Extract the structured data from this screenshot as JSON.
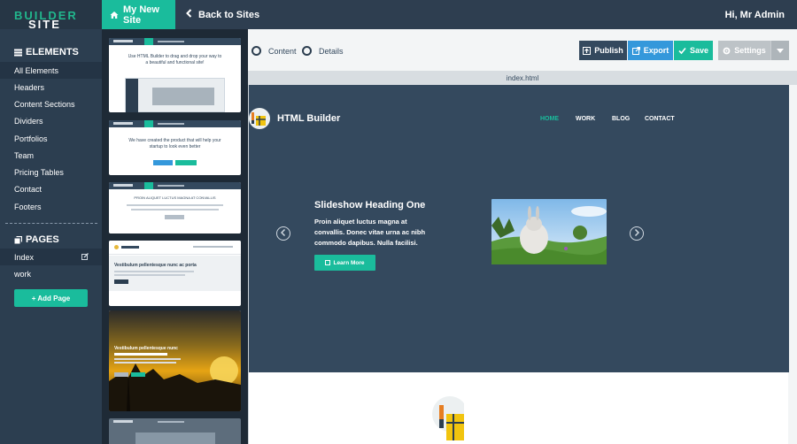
{
  "app": {
    "logo_part1": "SITE",
    "logo_part2": "BUILDER",
    "site_tab": "My New Site",
    "back_link": "Back to Sites",
    "greeting": "Hi, Mr Admin"
  },
  "sidebar": {
    "elements_heading": "ELEMENTS",
    "elements": [
      "All Elements",
      "Headers",
      "Content Sections",
      "Dividers",
      "Portfolios",
      "Team",
      "Pricing Tables",
      "Contact",
      "Footers"
    ],
    "pages_heading": "PAGES",
    "pages": [
      "Index",
      "work"
    ],
    "add_page": "+ Add Page"
  },
  "thumbnails": {
    "t1_text": "Use HTML Builder to drag and drop your way to a beautiful and functional site!",
    "t2_text": "We have created the product that will help your startup to look even better",
    "t3_text": "PROIN ALIQUET LUCTUS MAGNA AT CONVALLIS",
    "t4_heading": "Vestibulum pellentesque nunc ac porta",
    "t5_heading": "Vestibulum pellentesque nunc"
  },
  "toolbar": {
    "radio_content": "Content",
    "radio_details": "Details",
    "publish": "Publish",
    "export": "Export",
    "save": "Save",
    "settings": "Settings"
  },
  "canvas": {
    "file_name": "index.html",
    "brand": "HTML Builder",
    "nav": [
      "HOME",
      "WORK",
      "BLOG",
      "CONTACT"
    ],
    "slide_heading": "Slideshow Heading One",
    "slide_text": "Proin aliquet luctus magna at convallis. Donec vitae urna ac nibh commodo dapibus. Nulla facilisi.",
    "learn_more": "Learn More"
  },
  "colors": {
    "accent": "#1abc9c",
    "dark_navy": "#2c3e50",
    "hero_bg": "#34495e",
    "publish_bg": "#34495e",
    "export_bg": "#3498db",
    "save_bg": "#1abc9c",
    "settings_bg": "#bdc3c7"
  },
  "icons": {
    "site_tab": "home-icon",
    "back": "chevron-left-icon",
    "elements": "list-icon",
    "pages": "copy-icon",
    "edit_page": "pencil-square-icon",
    "publish": "upload-icon",
    "export": "external-link-icon",
    "save": "check-icon",
    "settings": "gear-icon",
    "settings_toggle": "caret-down-icon",
    "slide_prev": "chevron-left-circle-icon",
    "slide_next": "chevron-right-circle-icon",
    "learn_more": "cube-icon"
  }
}
